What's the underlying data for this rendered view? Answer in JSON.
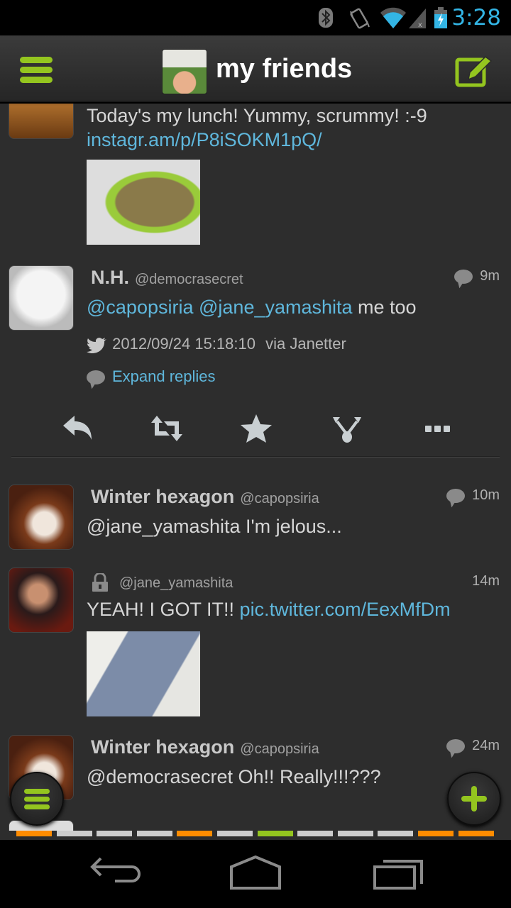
{
  "status_bar": {
    "time": "3:28",
    "icons": [
      "bluetooth-icon",
      "vibrate-icon",
      "wifi-icon",
      "signal-no-sim-icon",
      "battery-charging-icon"
    ]
  },
  "header": {
    "title": "my friends",
    "menu_icon": "hamburger-menu-icon",
    "compose_icon": "compose-edit-icon"
  },
  "colors": {
    "accent_green": "#94c51f",
    "link_blue": "#5fb7dc",
    "clock_blue": "#33b5e5",
    "orange": "#ff8c00",
    "grey_segment": "#cccccc",
    "background": "#2d2d2d"
  },
  "tweets": [
    {
      "body_text": "Today's my lunch! Yummy, scrummy! :-9",
      "link": "instagr.am/p/P8iSOKM1pQ/",
      "has_image": true
    },
    {
      "name": "N.H.",
      "handle": "@democrasecret",
      "time": "9m",
      "has_reply_bubble": true,
      "mention_1": "@capopsiria",
      "mention_2": "@jane_yamashita",
      "body_text": " me too",
      "timestamp": "2012/09/24 15:18:10",
      "via": "via Janetter",
      "expand_replies": "Expand replies",
      "actions": [
        "reply-icon",
        "retweet-icon",
        "favorite-star-icon",
        "share-fork-icon",
        "more-icon"
      ]
    },
    {
      "name": "Winter hexagon",
      "handle": "@capopsiria",
      "time": "10m",
      "has_reply_bubble": true,
      "body_text": "@jane_yamashita I'm jelous..."
    },
    {
      "name": "",
      "protected": true,
      "handle": "@jane_yamashita",
      "time": "14m",
      "body_text": "YEAH! I GOT IT!! ",
      "link": "pic.twitter.com/EexMfDm",
      "has_image": true
    },
    {
      "name": "Winter hexagon",
      "handle": "@capopsiria",
      "time": "24m",
      "has_reply_bubble": true,
      "body_text": "@democrasecret Oh!! Really!!!???"
    }
  ],
  "floating_buttons": {
    "left": "tabs-menu-icon",
    "right": "add-plus-icon"
  },
  "indicator_segments": [
    "orange",
    "grey",
    "grey",
    "grey",
    "orange",
    "grey",
    "green",
    "grey",
    "grey",
    "grey",
    "orange",
    "orange"
  ],
  "nav_bar": [
    "back-icon",
    "home-icon",
    "recent-apps-icon"
  ]
}
